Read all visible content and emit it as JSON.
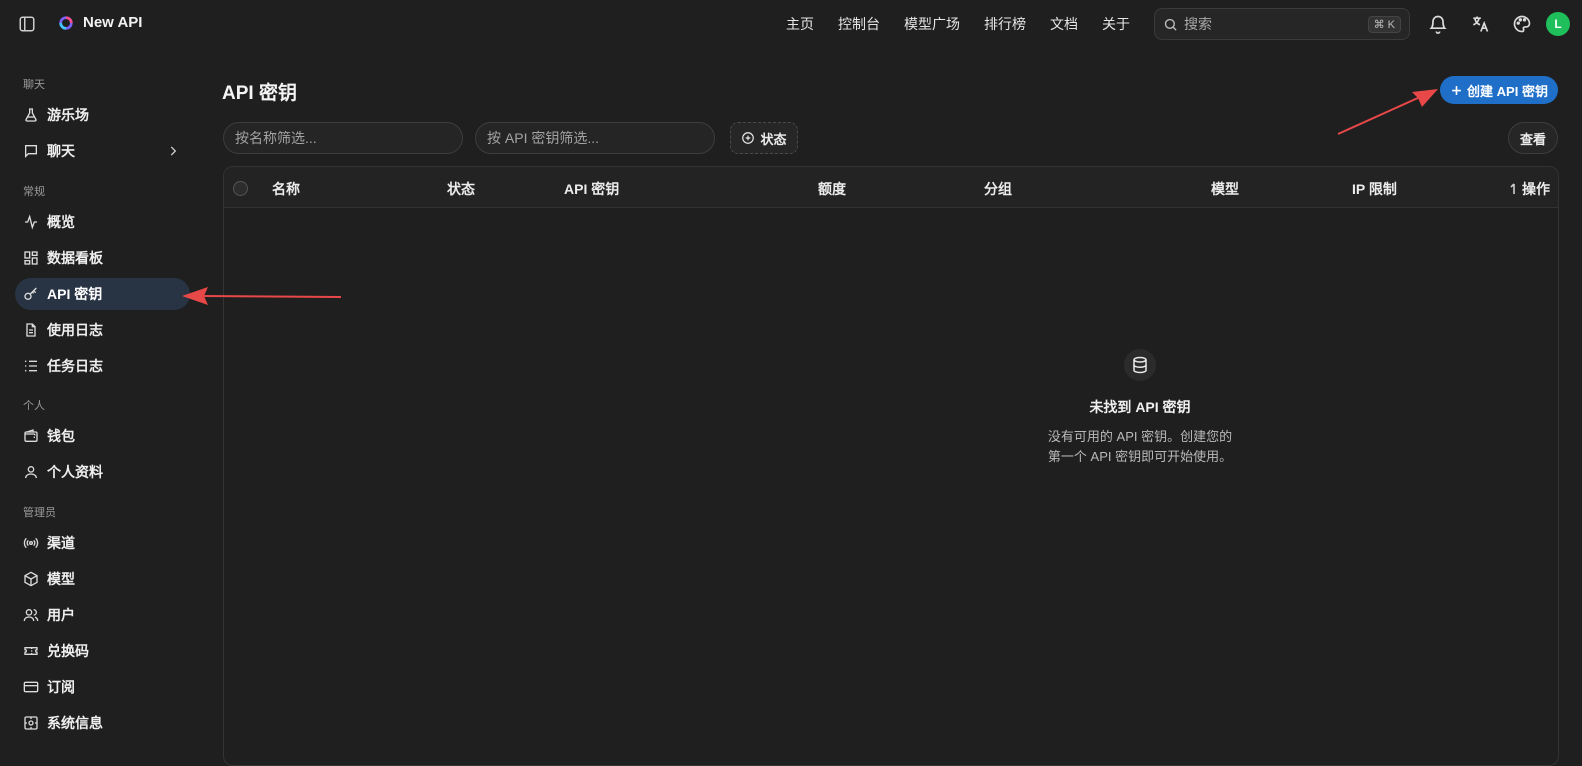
{
  "app": {
    "name": "New API"
  },
  "topnav": {
    "items": [
      "主页",
      "控制台",
      "模型广场",
      "排行榜",
      "文档",
      "关于"
    ],
    "search_placeholder": "搜索",
    "search_shortcut": "⌘ K",
    "avatar_initial": "L",
    "avatar_color": "#1fbf5c"
  },
  "sidebar": {
    "groups": [
      {
        "label": "聊天",
        "items": [
          {
            "label": "游乐场",
            "icon": "flask-icon"
          },
          {
            "label": "聊天",
            "icon": "chat-icon",
            "has_submenu": true
          }
        ]
      },
      {
        "label": "常规",
        "items": [
          {
            "label": "概览",
            "icon": "activity-icon"
          },
          {
            "label": "数据看板",
            "icon": "dashboard-icon"
          },
          {
            "label": "API 密钥",
            "icon": "key-icon",
            "active": true
          },
          {
            "label": "使用日志",
            "icon": "log-icon"
          },
          {
            "label": "任务日志",
            "icon": "task-list-icon"
          }
        ]
      },
      {
        "label": "个人",
        "items": [
          {
            "label": "钱包",
            "icon": "wallet-icon"
          },
          {
            "label": "个人资料",
            "icon": "user-icon"
          }
        ]
      },
      {
        "label": "管理员",
        "items": [
          {
            "label": "渠道",
            "icon": "broadcast-icon"
          },
          {
            "label": "模型",
            "icon": "box-icon"
          },
          {
            "label": "用户",
            "icon": "users-icon"
          },
          {
            "label": "兑换码",
            "icon": "ticket-icon"
          },
          {
            "label": "订阅",
            "icon": "card-icon"
          },
          {
            "label": "系统信息",
            "icon": "system-icon"
          }
        ]
      }
    ]
  },
  "main": {
    "title": "API 密钥",
    "create_button": "创建 API 密钥",
    "filter_name_placeholder": "按名称筛选...",
    "filter_key_placeholder": "按 API 密钥筛选...",
    "status_filter": "状态",
    "view_button": "查看",
    "table": {
      "columns": [
        "名称",
        "状态",
        "API 密钥",
        "额度",
        "分组",
        "模型",
        "IP 限制",
        "操作"
      ],
      "rows": []
    },
    "empty": {
      "icon": "database-icon",
      "title": "未找到 API 密钥",
      "line1": "没有可用的 API 密钥。创建您的",
      "line2": "第一个 API 密钥即可开始使用。"
    }
  },
  "colors": {
    "accent": "#1f6fc9",
    "active_nav_bg": "#283444",
    "annotation_arrow": "#e84848"
  }
}
